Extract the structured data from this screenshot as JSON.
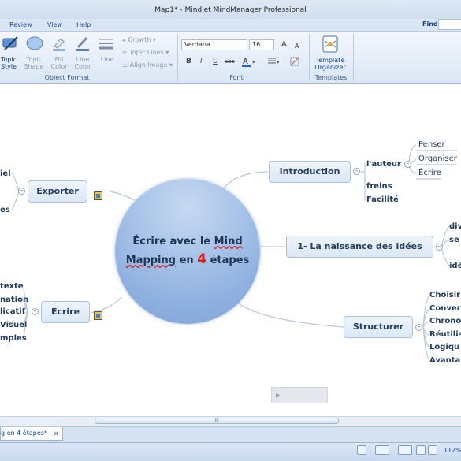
{
  "window": {
    "title": "Map1* - Mindjet MindManager Professional"
  },
  "menu": {
    "items": [
      "Review",
      "View",
      "Help"
    ],
    "find_label": "Find:"
  },
  "ribbon": {
    "object_format": {
      "label": "Object Format",
      "topic_style": "Topic\nStyle",
      "topic_shape": "Topic\nShape",
      "fill_color": "Fill\nColor",
      "line_color": "Line\nColor",
      "line": "Line",
      "growth": "Growth",
      "topic_lines": "Topic Lines",
      "align_image": "Align Image"
    },
    "font": {
      "label": "Font",
      "family": "Verdana",
      "size": "16",
      "bold": "B",
      "italic": "I",
      "underline": "U",
      "strike": "abc",
      "grow": "A",
      "shrink": "A"
    },
    "templates": {
      "label": "Templates",
      "organizer": "Template\nOrganizer"
    }
  },
  "map": {
    "central": {
      "line1a": "Écrire avec le ",
      "line1b": "Mind",
      "line2a": "Mapping",
      "line2b": " en ",
      "line2c": "4",
      "line2d": " étapes"
    },
    "topics": {
      "introduction": "Introduction",
      "naissance": "1- La naissance des idées",
      "structurer": "Structurer",
      "ecrire": "Écrire",
      "exporter": "Exporter"
    },
    "intro_children": {
      "auteur": "l'auteur",
      "freins": "freins",
      "facilite": "Facilité"
    },
    "auteur_children": [
      "Penser",
      "Organiser",
      "Écrire"
    ],
    "naissance_children": [
      "div",
      "se",
      "idé"
    ],
    "structurer_children": [
      "Choisir",
      "Conver",
      "Chrono",
      "Réutilis",
      "Logiqu",
      "Avanta"
    ],
    "ecrire_children": [
      "texte",
      "nation",
      "licatif",
      "Visuel",
      "mples"
    ],
    "exporter_children": [
      "iel",
      "es"
    ]
  },
  "tabs": {
    "document": "g en 4 étapes*",
    "close": "×"
  },
  "status": {
    "zoom": "112%"
  },
  "scroll": {
    "thumb": "III"
  },
  "colors": {
    "accent": "#15428b",
    "central_fill": "#8fb1e0",
    "highlight": "#e21818"
  }
}
